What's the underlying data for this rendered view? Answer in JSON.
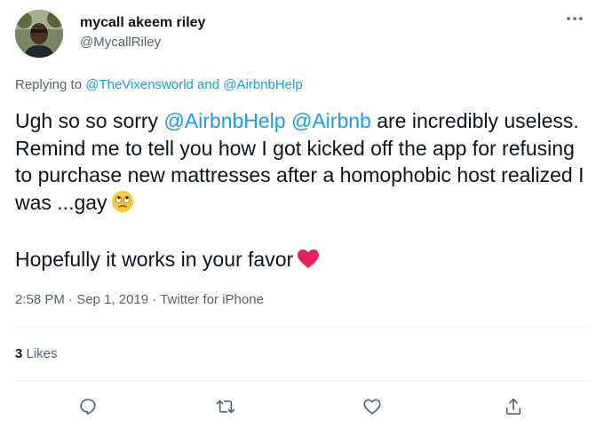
{
  "tweet": {
    "author": {
      "display_name": "mycall akeem riley",
      "handle": "@MycallRiley",
      "avatar_icon": "profile-photo"
    },
    "more_icon": "more-horizontal-icon",
    "replying": {
      "prefix": "Replying to ",
      "mention1": "@TheVixensworld",
      "joiner": " and ",
      "mention2": "@AirbnbHelp"
    },
    "body": {
      "p1_start": "Ugh so so sorry ",
      "mention_a": "@AirbnbHelp",
      "space": " ",
      "mention_b": "@Airbnb",
      "p1_rest": " are incredibly useless. Remind me to tell you how I got kicked off the app for refusing to purchase new mattresses  after a homophobic host realized I was ...gay",
      "emoji1": "rolling-eyes-emoji",
      "p2": "Hopefully it works in your favor",
      "emoji2": "red-heart-emoji"
    },
    "meta": {
      "time": "2:58 PM",
      "separator1": " · ",
      "date": "Sep 1, 2019",
      "separator2": " · ",
      "source": "Twitter for iPhone"
    },
    "likes": {
      "count": "3",
      "label": " Likes"
    },
    "actions": [
      "reply-icon",
      "retweet-icon",
      "like-icon",
      "share-icon"
    ],
    "colors": {
      "accent": "#1d9bf0",
      "secondary_text": "#536471",
      "heart": "#e0245e"
    }
  }
}
